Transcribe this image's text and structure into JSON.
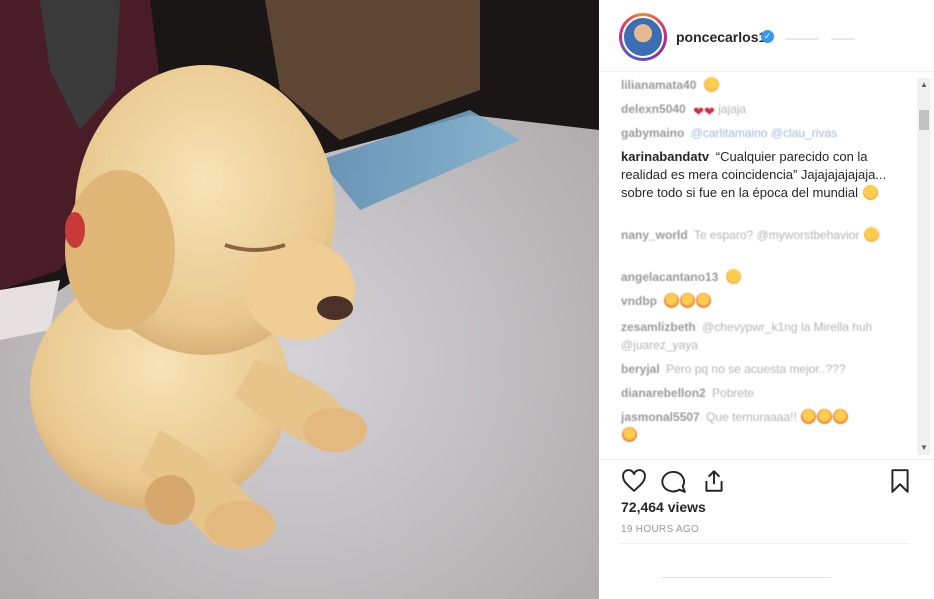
{
  "post": {
    "username": "poncecarlos1",
    "verified_icon": "verified-badge-icon",
    "views": "72,464 views",
    "timestamp": "19 HOURS AGO"
  },
  "media": {
    "description_icon": "puppy-video"
  },
  "comments": [
    {
      "user": "lilianamata40",
      "text": "",
      "emoji": "laugh"
    },
    {
      "user": "delexn5040",
      "text": "jajaja",
      "emoji": "hearts"
    },
    {
      "user": "gabymaino",
      "text": "@carlitamaino @clau_rivas",
      "emoji": ""
    },
    {
      "user": "karinabandatv",
      "text": "“Cualquier parecido con la realidad es mera coincidencia” Jajajajajajaja... sobre todo si fue en la época del mundial",
      "emoji": "laugh"
    },
    {
      "user": "nany_world",
      "text": "Te esparo? @myworstbehavior",
      "emoji": "laugh"
    },
    {
      "user": "angelacantano13",
      "text": "",
      "emoji": "laugh"
    },
    {
      "user": "vndbp",
      "text": "",
      "emoji": "heart-eyes"
    },
    {
      "user": "zesamlizbeth",
      "text": "@chevypwr_k1ng la Mirella huh @juarez_yaya",
      "emoji": ""
    },
    {
      "user": "beryjal",
      "text": "Pero pq no se acuesta mejor..???",
      "emoji": ""
    },
    {
      "user": "dianarebellon2",
      "text": "Pobrete",
      "emoji": ""
    },
    {
      "user": "jasmonal5507",
      "text": "Que ternuraaaa!!",
      "emoji": "heart-eyes"
    }
  ],
  "actions": {
    "like_icon": "heart-icon",
    "comment_icon": "comment-icon",
    "share_icon": "share-icon",
    "save_icon": "bookmark-icon"
  }
}
